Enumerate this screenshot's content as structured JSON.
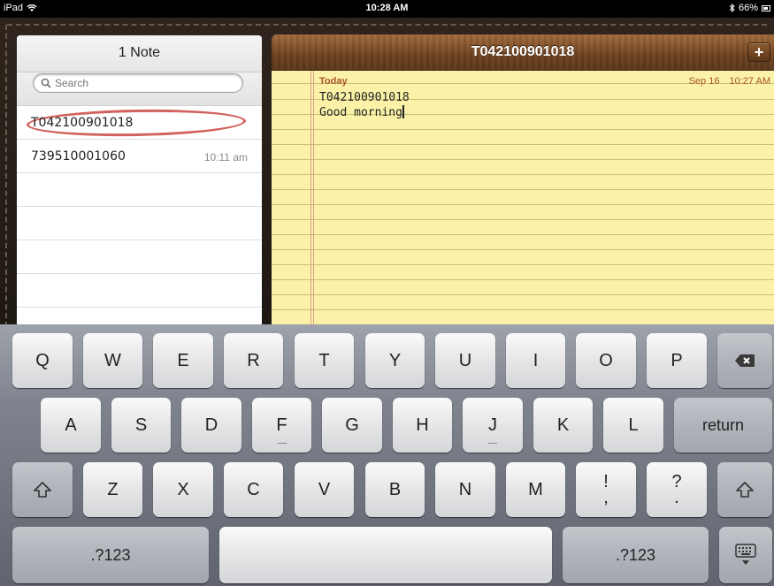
{
  "status_bar": {
    "device": "iPad",
    "time": "10:28 AM",
    "battery": "66%"
  },
  "notes_list": {
    "title": "1 Note",
    "search_placeholder": "Search",
    "items": [
      {
        "title": "T042100901018",
        "time": "",
        "selected": true
      },
      {
        "title": "739510001060",
        "time": "10:11 am",
        "selected": false
      }
    ]
  },
  "note": {
    "title": "T042100901018",
    "add_label": "+",
    "date_label": "Today",
    "date": "Sep 16",
    "time": "10:27 AM",
    "body_lines": [
      "T042100901018",
      "Good morning"
    ]
  },
  "keyboard": {
    "row1": [
      "Q",
      "W",
      "E",
      "R",
      "T",
      "Y",
      "U",
      "I",
      "O",
      "P"
    ],
    "row2": [
      "A",
      "S",
      "D",
      "F",
      "G",
      "H",
      "J",
      "K",
      "L"
    ],
    "row3": [
      "Z",
      "X",
      "C",
      "V",
      "B",
      "N",
      "M"
    ],
    "punct1": [
      "!",
      ","
    ],
    "punct2": [
      "?",
      "."
    ],
    "return_label": "return",
    "numbers_label": ".?123"
  }
}
